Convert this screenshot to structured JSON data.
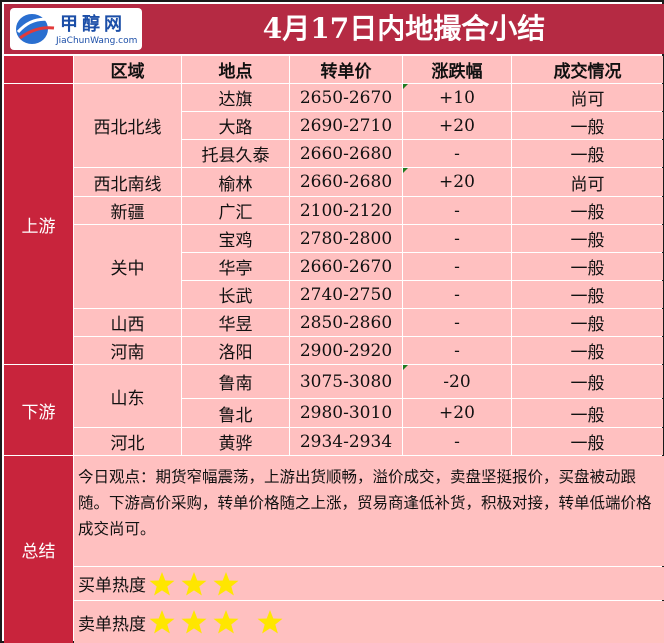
{
  "logo": {
    "cn": "甲醇网",
    "en": "JiaChunWang.com"
  },
  "title": "4月17日内地撮合小结",
  "columns": [
    "区域",
    "地点",
    "转单价",
    "涨跌幅",
    "成交情况"
  ],
  "sections": [
    {
      "name": "上游"
    },
    {
      "name": "下游"
    },
    {
      "name": "总结"
    }
  ],
  "regions": [
    "西北北线",
    "西北南线",
    "新疆",
    "关中",
    "山西",
    "河南",
    "山东",
    "河北"
  ],
  "rows": [
    {
      "place": "达旗",
      "price": "2650-2670",
      "change": "+10",
      "status": "尚可"
    },
    {
      "place": "大路",
      "price": "2690-2710",
      "change": "+20",
      "status": "一般"
    },
    {
      "place": "托县久泰",
      "price": "2660-2680",
      "change": "-",
      "status": "一般"
    },
    {
      "place": "榆林",
      "price": "2660-2680",
      "change": "+20",
      "status": "尚可"
    },
    {
      "place": "广汇",
      "price": "2100-2120",
      "change": "-",
      "status": "一般"
    },
    {
      "place": "宝鸡",
      "price": "2780-2800",
      "change": "-",
      "status": "一般"
    },
    {
      "place": "华亭",
      "price": "2660-2670",
      "change": "-",
      "status": "一般"
    },
    {
      "place": "长武",
      "price": "2740-2750",
      "change": "-",
      "status": "一般"
    },
    {
      "place": "华昱",
      "price": "2850-2860",
      "change": "-",
      "status": "一般"
    },
    {
      "place": "洛阳",
      "price": "2900-2920",
      "change": "-",
      "status": "一般"
    },
    {
      "place": "鲁南",
      "price": "3075-3080",
      "change": "-20",
      "status": "一般"
    },
    {
      "place": "鲁北",
      "price": "2980-3010",
      "change": "+20",
      "status": "一般"
    },
    {
      "place": "黄骅",
      "price": "2934-2934",
      "change": "-",
      "status": "一般"
    }
  ],
  "summary": {
    "text": "今日观点：期货窄幅震荡，上游出货顺畅，溢价成交，卖盘坚挺报价，买盘被动跟随。下游高价采购，转单价格随之上涨，贸易商逢低补货，积极对接，转单低端价格成交尚可。",
    "buy_label": "买单热度",
    "buy_stars": 3,
    "sell_label": "卖单热度",
    "sell_stars": 4
  },
  "colors": {
    "header": "#b52a43",
    "side": "#c8243c",
    "pink": "#ffc0c0",
    "star": "#ffe600",
    "mark": "#1f7a1f"
  }
}
